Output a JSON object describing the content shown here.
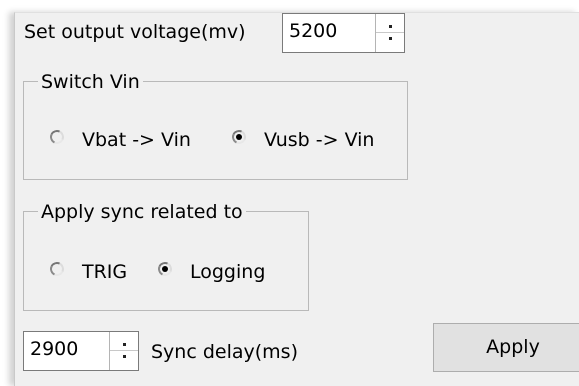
{
  "voltage": {
    "label": "Set output voltage(mv)",
    "value": "5200"
  },
  "switch_vin": {
    "title": "Switch Vin",
    "options": [
      {
        "label": "Vbat -> Vin",
        "selected": false
      },
      {
        "label": "Vusb -> Vin",
        "selected": true
      }
    ]
  },
  "sync": {
    "title": "Apply sync related to",
    "options": [
      {
        "label": "TRIG",
        "selected": false
      },
      {
        "label": "Logging",
        "selected": true
      }
    ]
  },
  "delay": {
    "value": "2900",
    "label": "Sync delay(ms)"
  },
  "apply_button": {
    "label": "Apply"
  }
}
